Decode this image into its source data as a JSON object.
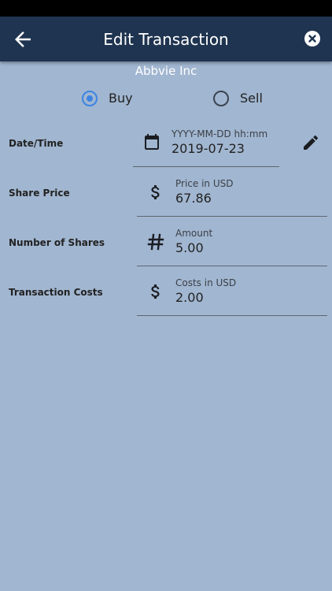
{
  "header": {
    "title": "Edit Transaction"
  },
  "company": {
    "name": "Abbvie Inc"
  },
  "transaction_type": {
    "options": [
      {
        "label": "Buy",
        "selected": true
      },
      {
        "label": "Sell",
        "selected": false
      }
    ]
  },
  "form": {
    "date_time": {
      "label": "Date/Time",
      "hint": "YYYY-MM-DD hh:mm",
      "value": "2019-07-23"
    },
    "share_price": {
      "label": "Share Price",
      "hint": "Price in USD",
      "value": "67.86"
    },
    "number_of_shares": {
      "label": "Number of Shares",
      "hint": "Amount",
      "value": "5.00"
    },
    "transaction_costs": {
      "label": "Transaction Costs",
      "hint": "Costs in USD",
      "value": "2.00"
    }
  },
  "icons": {
    "back": "arrow-left-icon",
    "close": "close-circle-icon",
    "calendar": "calendar-icon",
    "edit": "pencil-icon",
    "dollar": "dollar-icon",
    "hash": "hash-icon"
  },
  "colors": {
    "background": "#a1b6d0",
    "app_bar": "#1f3450",
    "accent": "#3d84e3"
  }
}
